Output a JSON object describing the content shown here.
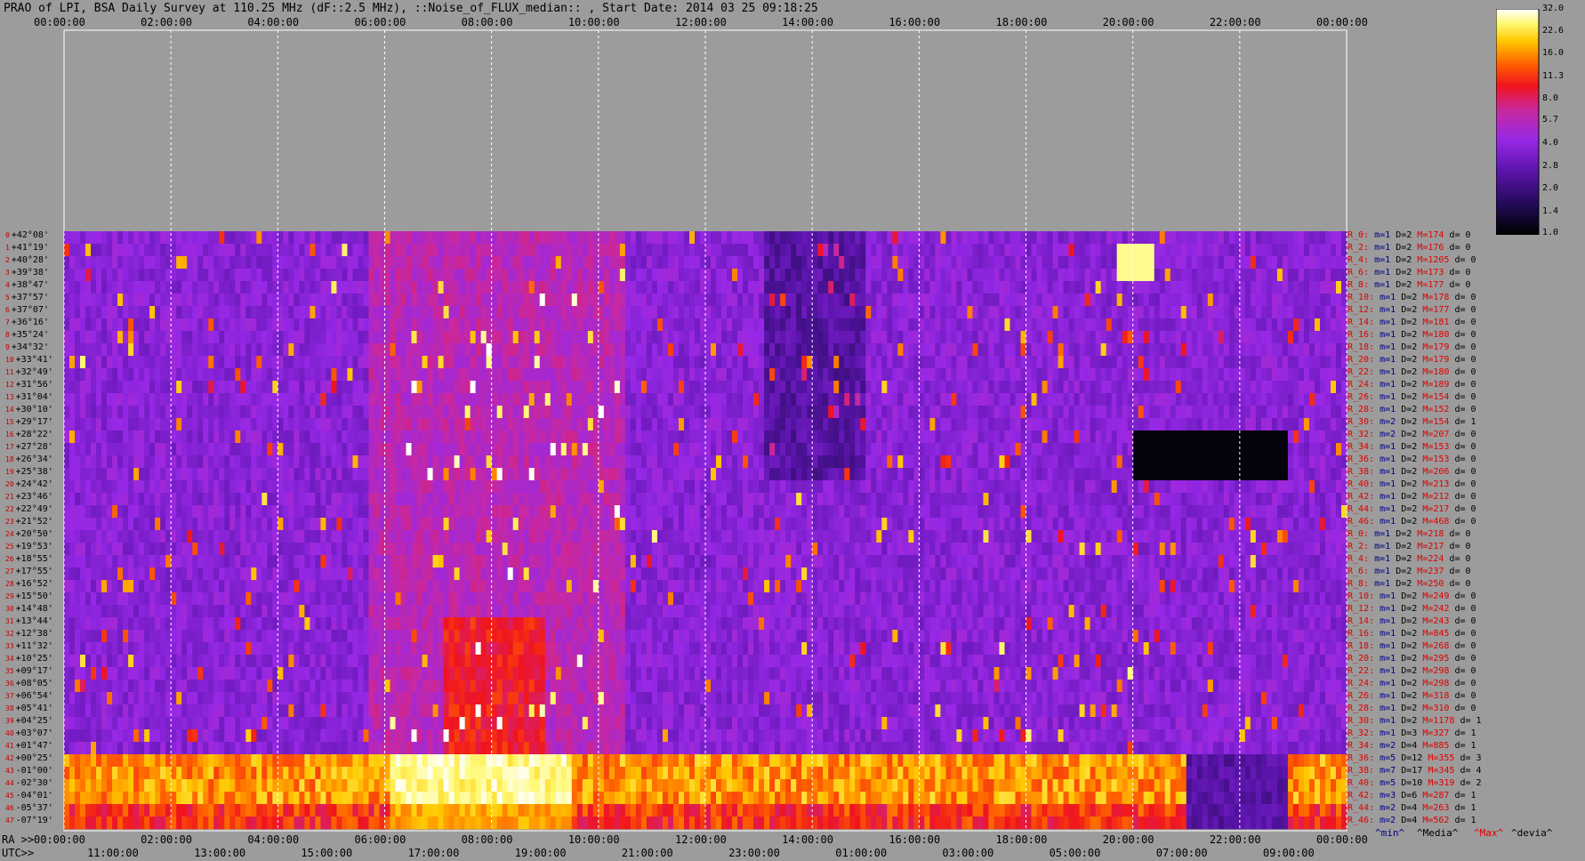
{
  "title": "PRAO of LPI, BSA Daily Survey at 110.25 MHz (dF::2.5 MHz), ::Noise_of_FLUX_median:: , Start Date: 2014 03 25 09:18:25",
  "top_ticks": [
    "00:00:00",
    "02:00:00",
    "04:00:00",
    "06:00:00",
    "08:00:00",
    "10:00:00",
    "12:00:00",
    "14:00:00",
    "16:00:00",
    "18:00:00",
    "20:00:00",
    "22:00:00",
    "00:00:00"
  ],
  "bottom_ra_prefix": "RA >>",
  "bottom_ra_ticks": [
    "00:00:00",
    "02:00:00",
    "04:00:00",
    "06:00:00",
    "08:00:00",
    "10:00:00",
    "12:00:00",
    "14:00:00",
    "16:00:00",
    "18:00:00",
    "20:00:00",
    "22:00:00",
    "00:00:00"
  ],
  "bottom_utc_prefix": "UTC>>",
  "bottom_utc_ticks": [
    "11:00:00",
    "13:00:00",
    "15:00:00",
    "17:00:00",
    "19:00:00",
    "21:00:00",
    "23:00:00",
    "01:00:00",
    "03:00:00",
    "05:00:00",
    "07:00:00",
    "09:00:00"
  ],
  "legend_footer": {
    "min": "^min^",
    "media": "^Media^",
    "max": "^Max^",
    "devia": "^devia^"
  },
  "colorbar_ticks": [
    "32.0",
    "22.6",
    "16.0",
    "11.3",
    "8.0",
    "5.7",
    "4.0",
    "2.8",
    "2.0",
    "1.4",
    "1.0"
  ],
  "colors": {
    "background": "#9c9c9c",
    "max_label": "#e00000",
    "min_label": "#00008b"
  },
  "declinations": [
    "+42°08'",
    "+41°19'",
    "+40°28'",
    "+39°38'",
    "+38°47'",
    "+37°57'",
    "+37°07'",
    "+36°16'",
    "+35°24'",
    "+34°32'",
    "+33°41'",
    "+32°49'",
    "+31°56'",
    "+31°04'",
    "+30°10'",
    "+29°17'",
    "+28°22'",
    "+27°28'",
    "+26°34'",
    "+25°38'",
    "+24°42'",
    "+23°46'",
    "+22°49'",
    "+21°52'",
    "+20°50'",
    "+19°53'",
    "+18°55'",
    "+17°55'",
    "+16°52'",
    "+15°50'",
    "+14°48'",
    "+13°44'",
    "+12°38'",
    "+11°32'",
    "+10°25'",
    "+09°17'",
    "+08°05'",
    "+06°54'",
    "+05°41'",
    "+04°25'",
    "+03°07'",
    "+01°47'",
    "+00°25'",
    "-01°00'",
    "-02°30'",
    "-04°01'",
    "-05°37'",
    "-07°19'"
  ],
  "ray_stats": [
    {
      "r": "R_0:",
      "m": "m=1",
      "d": "D=2",
      "M": "M=174",
      "dv": "d= 0"
    },
    {
      "r": "R_2:",
      "m": "m=1",
      "d": "D=2",
      "M": "M=176",
      "dv": "d= 0"
    },
    {
      "r": "R_4:",
      "m": "m=1",
      "d": "D=2",
      "M": "M=1205",
      "dv": "d= 0"
    },
    {
      "r": "R_6:",
      "m": "m=1",
      "d": "D=2",
      "M": "M=173",
      "dv": "d= 0"
    },
    {
      "r": "R_8:",
      "m": "m=1",
      "d": "D=2",
      "M": "M=177",
      "dv": "d= 0"
    },
    {
      "r": "R_10:",
      "m": "m=1",
      "d": "D=2",
      "M": "M=178",
      "dv": "d= 0"
    },
    {
      "r": "R_12:",
      "m": "m=1",
      "d": "D=2",
      "M": "M=177",
      "dv": "d= 0"
    },
    {
      "r": "R_14:",
      "m": "m=1",
      "d": "D=2",
      "M": "M=181",
      "dv": "d= 0"
    },
    {
      "r": "R_16:",
      "m": "m=1",
      "d": "D=2",
      "M": "M=180",
      "dv": "d= 0"
    },
    {
      "r": "R_18:",
      "m": "m=1",
      "d": "D=2",
      "M": "M=179",
      "dv": "d= 0"
    },
    {
      "r": "R_20:",
      "m": "m=1",
      "d": "D=2",
      "M": "M=179",
      "dv": "d= 0"
    },
    {
      "r": "R_22:",
      "m": "m=1",
      "d": "D=2",
      "M": "M=180",
      "dv": "d= 0"
    },
    {
      "r": "R_24:",
      "m": "m=1",
      "d": "D=2",
      "M": "M=189",
      "dv": "d= 0"
    },
    {
      "r": "R_26:",
      "m": "m=1",
      "d": "D=2",
      "M": "M=154",
      "dv": "d= 0"
    },
    {
      "r": "R_28:",
      "m": "m=1",
      "d": "D=2",
      "M": "M=152",
      "dv": "d= 0"
    },
    {
      "r": "R_30:",
      "m": "m=2",
      "d": "D=2",
      "M": "M=154",
      "dv": "d= 1"
    },
    {
      "r": "R_32:",
      "m": "m=2",
      "d": "D=2",
      "M": "M=207",
      "dv": "d= 0"
    },
    {
      "r": "R_34:",
      "m": "m=1",
      "d": "D=2",
      "M": "M=153",
      "dv": "d= 0"
    },
    {
      "r": "R_36:",
      "m": "m=1",
      "d": "D=2",
      "M": "M=153",
      "dv": "d= 0"
    },
    {
      "r": "R_38:",
      "m": "m=1",
      "d": "D=2",
      "M": "M=206",
      "dv": "d= 0"
    },
    {
      "r": "R_40:",
      "m": "m=1",
      "d": "D=2",
      "M": "M=213",
      "dv": "d= 0"
    },
    {
      "r": "R_42:",
      "m": "m=1",
      "d": "D=2",
      "M": "M=212",
      "dv": "d= 0"
    },
    {
      "r": "R_44:",
      "m": "m=1",
      "d": "D=2",
      "M": "M=217",
      "dv": "d= 0"
    },
    {
      "r": "R_46:",
      "m": "m=1",
      "d": "D=2",
      "M": "M=468",
      "dv": "d= 0"
    },
    {
      "r": "R_0:",
      "m": "m=1",
      "d": "D=2",
      "M": "M=218",
      "dv": "d= 0"
    },
    {
      "r": "R_2:",
      "m": "m=1",
      "d": "D=2",
      "M": "M=217",
      "dv": "d= 0"
    },
    {
      "r": "R_4:",
      "m": "m=1",
      "d": "D=2",
      "M": "M=224",
      "dv": "d= 0"
    },
    {
      "r": "R_6:",
      "m": "m=1",
      "d": "D=2",
      "M": "M=237",
      "dv": "d= 0"
    },
    {
      "r": "R_8:",
      "m": "m=1",
      "d": "D=2",
      "M": "M=250",
      "dv": "d= 0"
    },
    {
      "r": "R_10:",
      "m": "m=1",
      "d": "D=2",
      "M": "M=249",
      "dv": "d= 0"
    },
    {
      "r": "R_12:",
      "m": "m=1",
      "d": "D=2",
      "M": "M=242",
      "dv": "d= 0"
    },
    {
      "r": "R_14:",
      "m": "m=1",
      "d": "D=2",
      "M": "M=243",
      "dv": "d= 0"
    },
    {
      "r": "R_16:",
      "m": "m=1",
      "d": "D=2",
      "M": "M=845",
      "dv": "d= 0"
    },
    {
      "r": "R_18:",
      "m": "m=1",
      "d": "D=2",
      "M": "M=268",
      "dv": "d= 0"
    },
    {
      "r": "R_20:",
      "m": "m=1",
      "d": "D=2",
      "M": "M=295",
      "dv": "d= 0"
    },
    {
      "r": "R_22:",
      "m": "m=1",
      "d": "D=2",
      "M": "M=298",
      "dv": "d= 0"
    },
    {
      "r": "R_24:",
      "m": "m=1",
      "d": "D=2",
      "M": "M=298",
      "dv": "d= 0"
    },
    {
      "r": "R_26:",
      "m": "m=1",
      "d": "D=2",
      "M": "M=318",
      "dv": "d= 0"
    },
    {
      "r": "R_28:",
      "m": "m=1",
      "d": "D=2",
      "M": "M=310",
      "dv": "d= 0"
    },
    {
      "r": "R_30:",
      "m": "m=1",
      "d": "D=2",
      "M": "M=1178",
      "dv": "d= 1"
    },
    {
      "r": "R_32:",
      "m": "m=1",
      "d": "D=3",
      "M": "M=327",
      "dv": "d= 1"
    },
    {
      "r": "R_34:",
      "m": "m=2",
      "d": "D=4",
      "M": "M=885",
      "dv": "d= 1"
    },
    {
      "r": "R_36:",
      "m": "m=5",
      "d": "D=12",
      "M": "M=355",
      "dv": "d= 3"
    },
    {
      "r": "R_38:",
      "m": "m=7",
      "d": "D=17",
      "M": "M=345",
      "dv": "d= 4"
    },
    {
      "r": "R_40:",
      "m": "m=5",
      "d": "D=10",
      "M": "M=319",
      "dv": "d= 2"
    },
    {
      "r": "R_42:",
      "m": "m=3",
      "d": "D=6",
      "M": "M=287",
      "dv": "d= 1"
    },
    {
      "r": "R_44:",
      "m": "m=2",
      "d": "D=4",
      "M": "M=263",
      "dv": "d= 1"
    },
    {
      "r": "R_46:",
      "m": "m=2",
      "d": "D=4",
      "M": "M=562",
      "dv": "d= 1"
    }
  ],
  "chart_data": {
    "type": "heatmap",
    "title": "PRAO of LPI, BSA Daily Survey at 110.25 MHz (dF::2.5 MHz), ::Noise_of_FLUX_median:: , Start Date: 2014 03 25 09:18:25",
    "x_axis": "RA (hours, 00:00:00 to 00:00:00 next)",
    "y_axis": "Declination (+42°08' to -07°19')",
    "colorscale": {
      "min": 1.0,
      "max": 32.0,
      "ticks": [
        32.0,
        22.6,
        16.0,
        11.3,
        8.0,
        5.7,
        4.0,
        2.8,
        2.0,
        1.4,
        1.0
      ]
    },
    "bright_band_rows": [
      42,
      43,
      44,
      45,
      46,
      47
    ],
    "quiet_block_ra_hours": [
      21.0,
      22.8
    ],
    "dark_patch": {
      "ra_hours": [
        20.0,
        22.8
      ],
      "rows": [
        16,
        19
      ]
    },
    "bright_source": {
      "ra_hours": 20.0,
      "row": 2
    }
  }
}
